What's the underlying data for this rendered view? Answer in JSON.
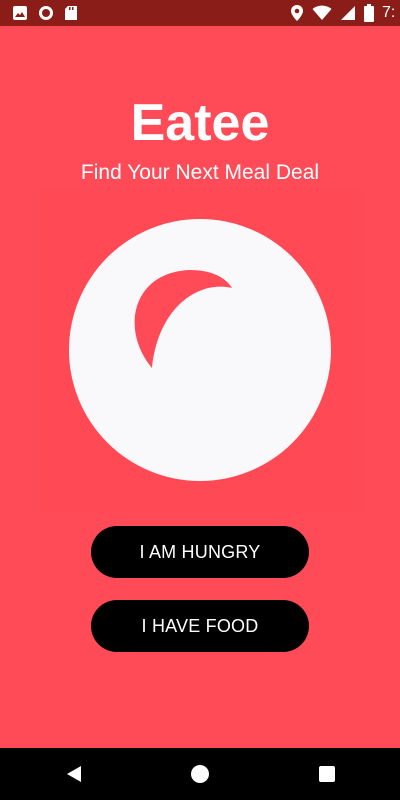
{
  "status_bar": {
    "time": "7:",
    "left_icons": [
      "image-icon",
      "sync-circle-icon",
      "sd-card-icon"
    ],
    "right_icons": [
      "location-pin-icon",
      "wifi-icon",
      "signal-icon",
      "battery-icon"
    ]
  },
  "app": {
    "title": "Eatee",
    "subtitle": "Find Your Next Meal Deal",
    "logo_icon": "eatee-logo-icon"
  },
  "buttons": {
    "hungry_label": "I AM HUNGRY",
    "food_label": "I HAVE FOOD"
  },
  "nav_bar": {
    "icons": [
      "back-triangle-icon",
      "home-circle-icon",
      "recents-square-icon"
    ]
  },
  "colors": {
    "background": "#ff4b57",
    "status_bar": "#8a1d17",
    "button": "#000000",
    "button_text": "#ffffff",
    "logo_circle": "#f9f9fc",
    "nav_bar": "#000000"
  }
}
